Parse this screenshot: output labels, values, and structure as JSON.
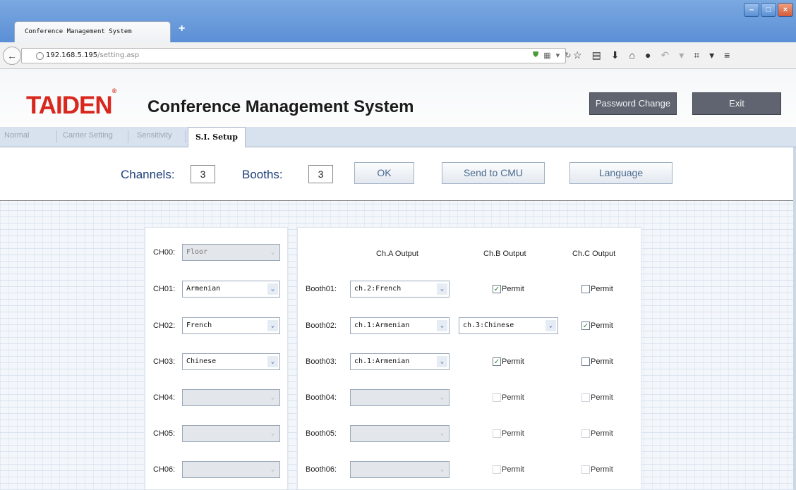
{
  "browser": {
    "tab_title": "Conference Management System",
    "new_tab": "+",
    "url_host": "192.168.5.195",
    "url_path": "/setting.asp",
    "window_buttons": [
      "minimize-icon",
      "maximize-icon",
      "close-icon"
    ]
  },
  "header": {
    "logo": "TAIDEN",
    "logo_mark": "®",
    "title": "Conference Management System",
    "password_change": "Password Change",
    "exit": "Exit",
    "accent_color": "#d9271e"
  },
  "tabs": [
    "Normal",
    "Carrier Setting",
    "Sensitivity",
    "S.I. Setup"
  ],
  "active_tab": "S.I. Setup",
  "settings": {
    "channels_label": "Channels:",
    "channels_value": "3",
    "booths_label": "Booths:",
    "booths_value": "3",
    "ok": "OK",
    "send_to_cmu": "Send to CMU",
    "language": "Language"
  },
  "channels": [
    {
      "label": "CH00:",
      "value": "Floor",
      "disabled": true
    },
    {
      "label": "CH01:",
      "value": "Armenian",
      "disabled": false
    },
    {
      "label": "CH02:",
      "value": "French",
      "disabled": false
    },
    {
      "label": "CH03:",
      "value": "Chinese",
      "disabled": false
    },
    {
      "label": "CH04:",
      "value": "",
      "disabled": true
    },
    {
      "label": "CH05:",
      "value": "",
      "disabled": true
    },
    {
      "label": "CH06:",
      "value": "",
      "disabled": true
    }
  ],
  "booth_columns": [
    "Ch.A Output",
    "Ch.B Output",
    "Ch.C Output"
  ],
  "booths": [
    {
      "label": "Booth01:",
      "ch_a": "ch.2:French",
      "ch_b": {
        "checked": true,
        "text": "Permit"
      },
      "ch_c": {
        "checked": false,
        "text": "Permit"
      }
    },
    {
      "label": "Booth02:",
      "ch_a": "ch.1:Armenian",
      "ch_b_select": "ch.3:Chinese",
      "ch_c": {
        "checked": true,
        "text": "Permit"
      }
    },
    {
      "label": "Booth03:",
      "ch_a": "ch.1:Armenian",
      "ch_b": {
        "checked": true,
        "text": "Permit"
      },
      "ch_c": {
        "checked": false,
        "text": "Permit"
      }
    },
    {
      "label": "Booth04:",
      "ch_a": "",
      "ch_b": {
        "checked": false,
        "text": "Permit"
      },
      "ch_c": {
        "checked": false,
        "text": "Permit"
      }
    },
    {
      "label": "Booth05:",
      "ch_a": "",
      "ch_b": {
        "checked": false,
        "text": "Permit"
      },
      "ch_c": {
        "checked": false,
        "text": "Permit"
      }
    },
    {
      "label": "Booth06:",
      "ch_a": "",
      "ch_b": {
        "checked": false,
        "text": "Permit"
      },
      "ch_c": {
        "checked": false,
        "text": "Permit"
      }
    }
  ]
}
